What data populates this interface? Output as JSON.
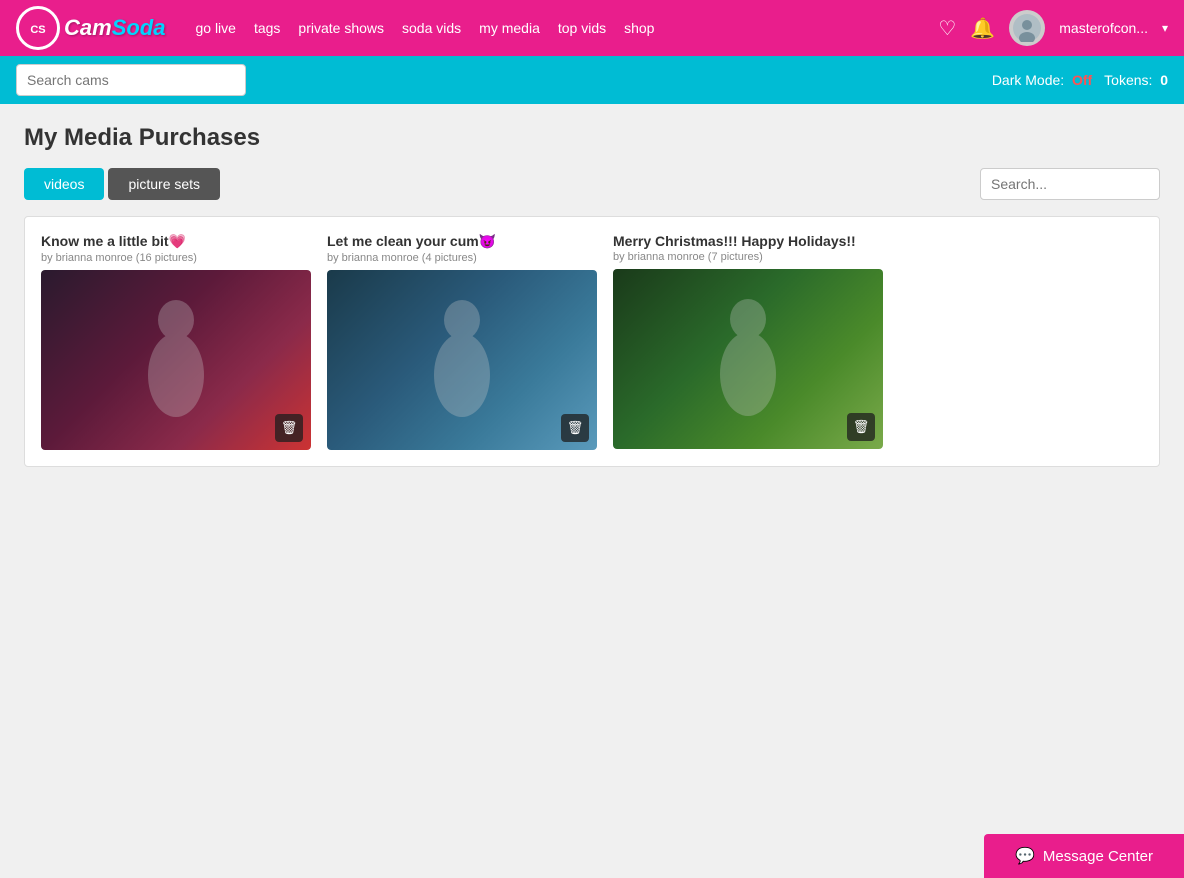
{
  "brand": {
    "name_cam": "Cam",
    "name_soda": "Soda"
  },
  "nav": {
    "go_live": "go live",
    "tags": "tags",
    "private_shows": "private shows",
    "soda_vids": "soda vids",
    "my_media": "my media",
    "top_vids": "top vids",
    "shop": "shop",
    "username": "masterofcon...",
    "dropdown_icon": "▾"
  },
  "search_bar": {
    "placeholder": "Search cams",
    "dark_mode_label": "Dark Mode:",
    "dark_mode_value": "Off",
    "tokens_label": "Tokens:",
    "tokens_value": "0"
  },
  "page": {
    "title": "My Media Purchases"
  },
  "tabs": {
    "videos_label": "videos",
    "picture_sets_label": "picture sets",
    "search_placeholder": "Search..."
  },
  "media_items": [
    {
      "title": "Know me a little bit💗",
      "subtitle": "by brianna monroe (16 pictures)",
      "thumbnail_class": "media-thumbnail-1"
    },
    {
      "title": "Let me clean your cum😈",
      "subtitle": "by brianna monroe (4 pictures)",
      "thumbnail_class": "media-thumbnail-2"
    },
    {
      "title": "Merry Christmas!!! Happy Holidays!!",
      "subtitle": "by brianna monroe (7 pictures)",
      "thumbnail_class": "media-thumbnail-3"
    }
  ],
  "message_center": {
    "label": "Message Center"
  }
}
